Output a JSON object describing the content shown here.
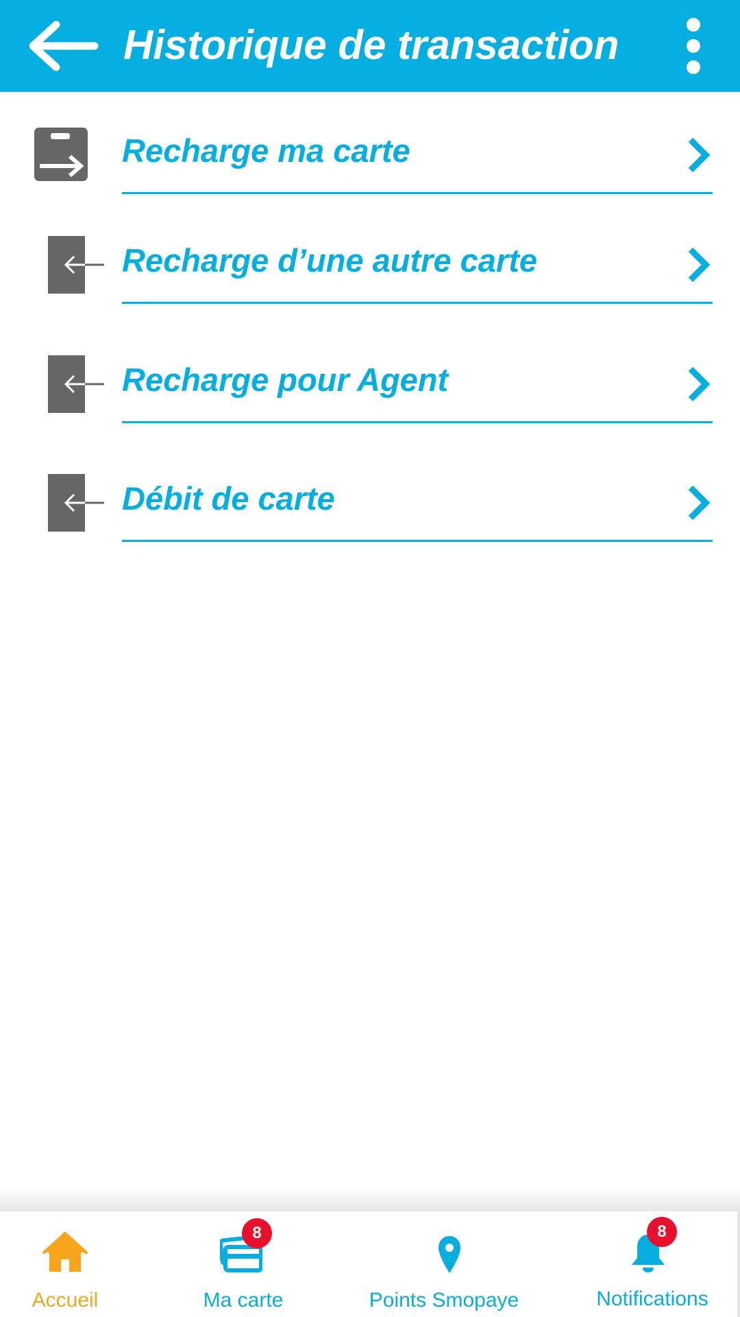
{
  "header": {
    "title": "Historique de transaction",
    "back_icon": "arrow-left-icon",
    "menu_icon": "more-vertical-icon"
  },
  "menu": {
    "items": [
      {
        "label": "Recharge ma carte",
        "icon": "transfer-out-icon"
      },
      {
        "label": "Recharge d’une autre carte",
        "icon": "arrow-in-icon"
      },
      {
        "label": "Recharge pour Agent",
        "icon": "arrow-in-icon"
      },
      {
        "label": "Débit de carte",
        "icon": "arrow-in-icon"
      }
    ],
    "chevron_icon": "chevron-right-icon"
  },
  "bottom_nav": {
    "items": [
      {
        "label": "Accueil",
        "icon": "home-icon",
        "active": true
      },
      {
        "label": "Ma carte",
        "icon": "cards-icon",
        "badge": "8"
      },
      {
        "label": "Points Smopaye",
        "icon": "map-pin-icon"
      },
      {
        "label": "Notifications",
        "icon": "bell-icon",
        "badge": "8"
      }
    ]
  },
  "colors": {
    "primary": "#05aee1",
    "icon_gray": "#666666",
    "active_nav": "#f7a51c",
    "badge": "#e8112d",
    "background": "#ffffff"
  }
}
